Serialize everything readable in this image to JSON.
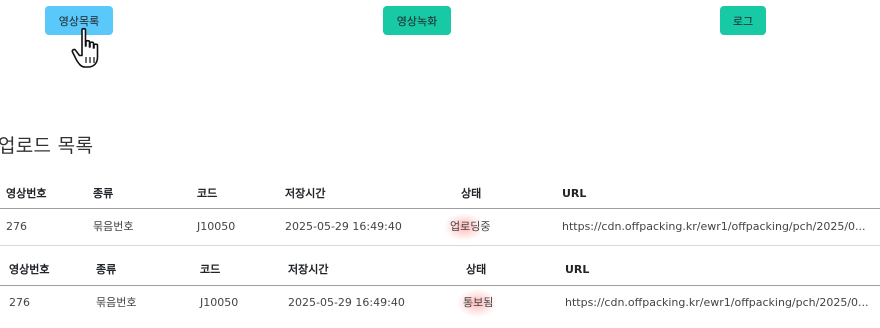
{
  "nav": {
    "list_label": "영상목록",
    "record_label": "영상녹화",
    "log_label": "로그"
  },
  "section_title": "업로드 목록",
  "tables": [
    {
      "headers": [
        "영상번호",
        "종류",
        "코드",
        "저장시간",
        "상태",
        "URL"
      ],
      "rows": [
        [
          "276",
          "묶음번호",
          "J10050",
          "2025-05-29 16:49:40",
          "업로딩중",
          "https://cdn.offpacking.kr/ewr1/offpacking/pch/2025/0..."
        ]
      ]
    },
    {
      "headers": [
        "영상번호",
        "종류",
        "코드",
        "저장시간",
        "상태",
        "URL"
      ],
      "rows": [
        [
          "276",
          "묶음번호",
          "J10050",
          "2025-05-29 16:49:40",
          "통보됨",
          "https://cdn.offpacking.kr/ewr1/offpacking/pch/2025/0..."
        ]
      ]
    }
  ],
  "colors": {
    "list_button": "#5ac8fa",
    "teal_button": "#17c9a4",
    "url_link": "#2f55d4"
  },
  "icons": {
    "cursor": "hand-pointer-icon"
  }
}
